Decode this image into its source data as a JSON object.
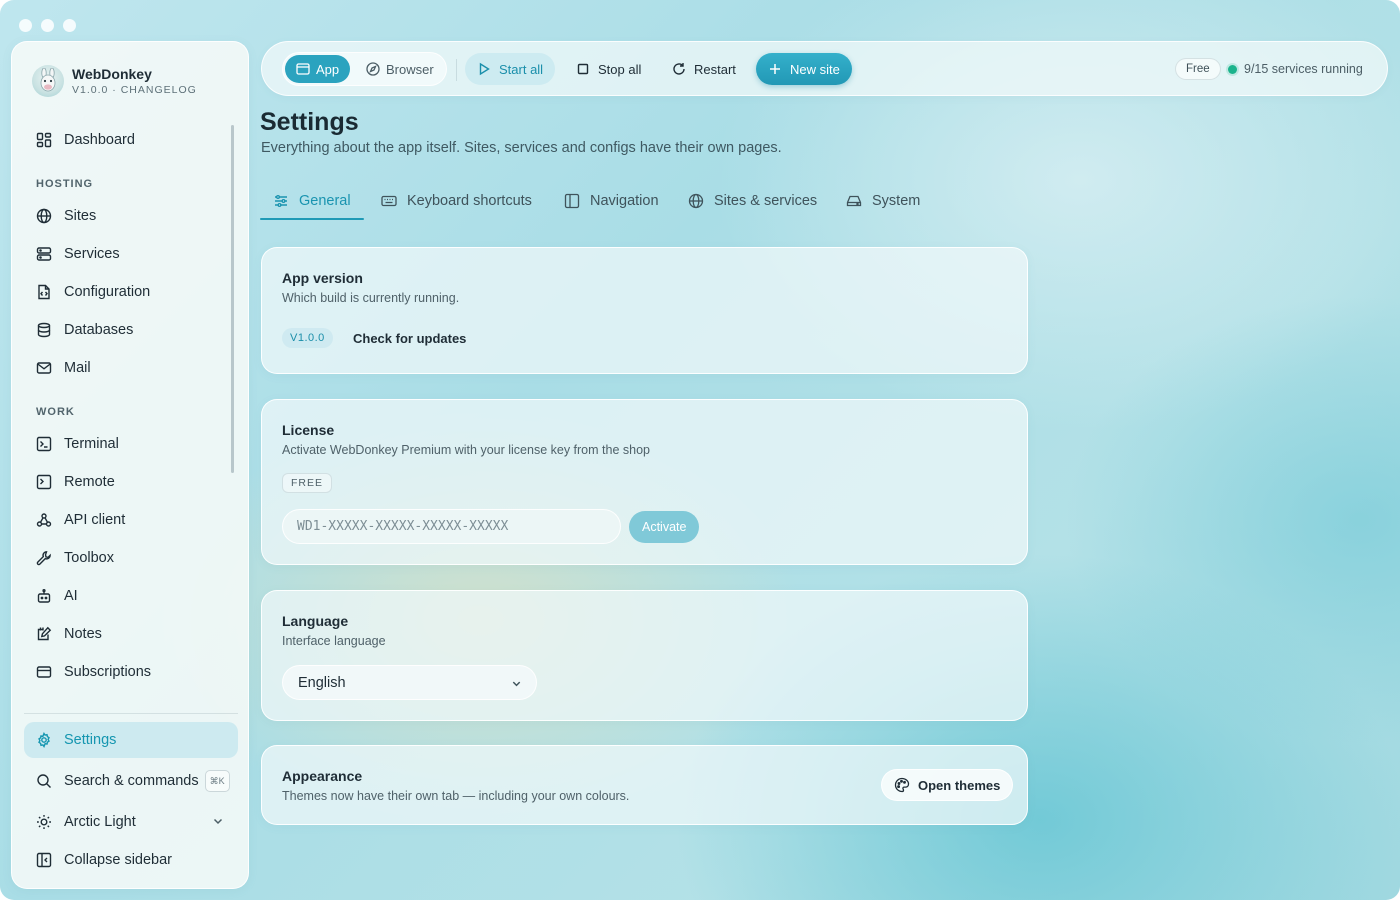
{
  "app": {
    "name": "WebDonkey",
    "subtitle": "V1.0.0 · CHANGELOG"
  },
  "sidebar": {
    "top_items": [
      {
        "label": "Dashboard",
        "icon": "dashboard-icon"
      }
    ],
    "sections": [
      {
        "title": "HOSTING",
        "items": [
          {
            "label": "Sites",
            "icon": "globe-icon"
          },
          {
            "label": "Services",
            "icon": "server-icon"
          },
          {
            "label": "Configuration",
            "icon": "config-file-icon"
          },
          {
            "label": "Databases",
            "icon": "database-icon"
          },
          {
            "label": "Mail",
            "icon": "mail-icon"
          }
        ]
      },
      {
        "title": "WORK",
        "items": [
          {
            "label": "Terminal",
            "icon": "terminal-icon"
          },
          {
            "label": "Remote",
            "icon": "remote-icon"
          },
          {
            "label": "API client",
            "icon": "webhook-icon"
          },
          {
            "label": "Toolbox",
            "icon": "wrench-icon"
          },
          {
            "label": "AI",
            "icon": "bot-icon"
          },
          {
            "label": "Notes",
            "icon": "notes-icon"
          },
          {
            "label": "Subscriptions",
            "icon": "card-icon"
          }
        ]
      }
    ],
    "bottom": {
      "settings": "Settings",
      "search": "Search & commands",
      "search_shortcut": "⌘K",
      "theme": "Arctic Light",
      "collapse": "Collapse sidebar"
    }
  },
  "toolbar": {
    "mode_app": "App",
    "mode_browser": "Browser",
    "start_all": "Start all",
    "stop_all": "Stop all",
    "restart": "Restart",
    "new_site": "New site",
    "plan": "Free",
    "status": "9/15 services running",
    "status_color": "#1bb38c",
    "accent_color": "#2ba3bf"
  },
  "page": {
    "title": "Settings",
    "subtitle": "Everything about the app itself. Sites, services and configs have their own pages."
  },
  "tabs": [
    {
      "label": "General",
      "icon": "sliders-icon",
      "active": true
    },
    {
      "label": "Keyboard shortcuts",
      "icon": "keyboard-icon",
      "active": false
    },
    {
      "label": "Navigation",
      "icon": "sidebar-layout-icon",
      "active": false
    },
    {
      "label": "Sites & services",
      "icon": "globe-icon",
      "active": false
    },
    {
      "label": "System",
      "icon": "drive-icon",
      "active": false
    }
  ],
  "cards": {
    "version": {
      "title": "App version",
      "desc": "Which build is currently running.",
      "version": "V1.0.0",
      "check_label": "Check for updates"
    },
    "license": {
      "title": "License",
      "desc": "Activate WebDonkey Premium with your license key from the shop",
      "plan": "FREE",
      "placeholder": "WD1-XXXXX-XXXXX-XXXXX-XXXXX",
      "activate_label": "Activate"
    },
    "language": {
      "title": "Language",
      "desc": "Interface language",
      "selected": "English"
    },
    "appearance": {
      "title": "Appearance",
      "desc": "Themes now have their own tab — including your own colours.",
      "button": "Open themes"
    }
  }
}
